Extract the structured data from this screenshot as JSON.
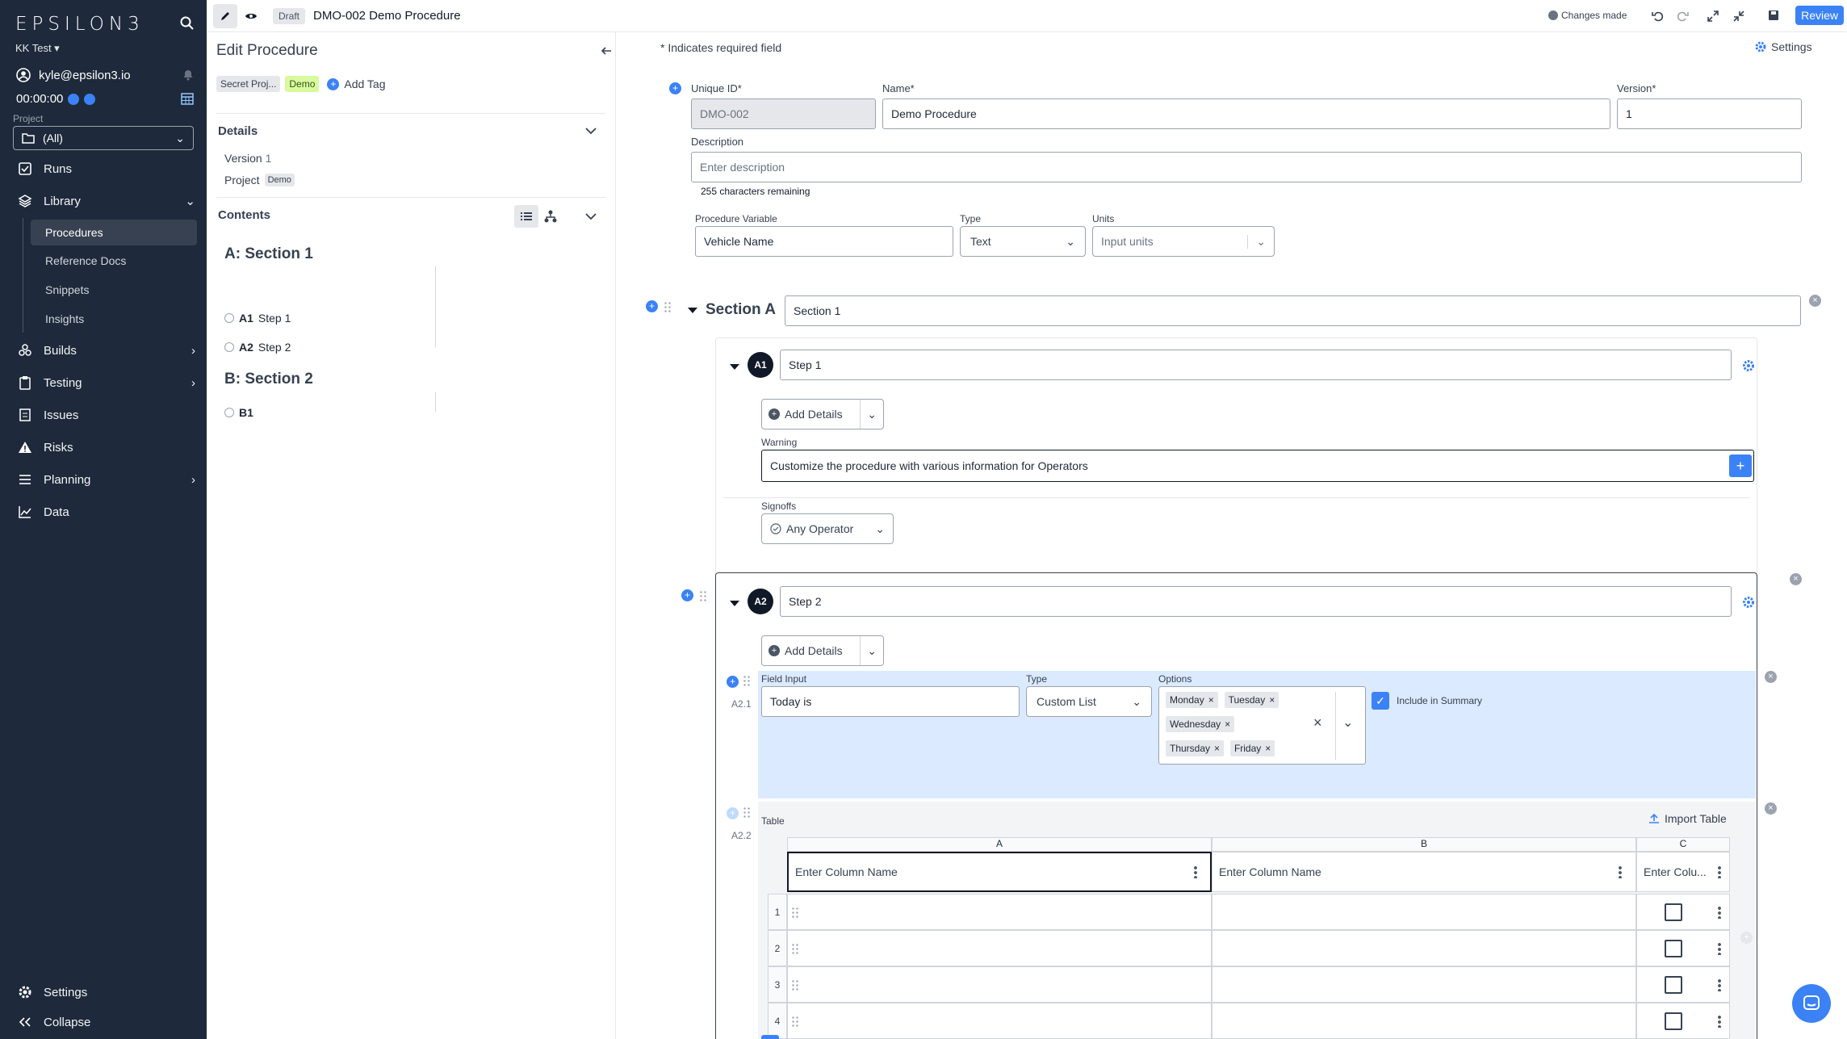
{
  "sidebar": {
    "logo": "EPSILON3",
    "org": "KK Test",
    "user": "kyle@epsilon3.io",
    "timer": "00:00:00",
    "project_label": "Project",
    "project_value": "(All)",
    "nav": [
      {
        "label": "Runs"
      },
      {
        "label": "Library"
      },
      {
        "label": "Builds"
      },
      {
        "label": "Testing"
      },
      {
        "label": "Issues"
      },
      {
        "label": "Risks"
      },
      {
        "label": "Planning"
      },
      {
        "label": "Data"
      }
    ],
    "library_items": [
      "Procedures",
      "Reference Docs",
      "Snippets",
      "Insights"
    ],
    "settings": "Settings",
    "collapse": "Collapse"
  },
  "topbar": {
    "status_badge": "Draft",
    "title": "DMO-002 Demo Procedure",
    "changes": "Changes made",
    "review": "Review"
  },
  "panel": {
    "title": "Edit Procedure",
    "tags": [
      "Secret Proj...",
      "Demo"
    ],
    "add_tag": "Add Tag",
    "details_header": "Details",
    "version_label": "Version",
    "version_value": "1",
    "project_label": "Project",
    "project_value": "Demo",
    "contents_header": "Contents",
    "sections": [
      {
        "title": "A: Section 1",
        "steps": [
          {
            "id": "A1",
            "name": "Step 1"
          },
          {
            "id": "A2",
            "name": "Step 2"
          }
        ]
      },
      {
        "title": "B: Section 2",
        "steps": [
          {
            "id": "B1",
            "name": ""
          }
        ]
      }
    ]
  },
  "main": {
    "required_note": "* Indicates required field",
    "settings": "Settings",
    "unique_id_label": "Unique ID*",
    "unique_id": "DMO-002",
    "name_label": "Name*",
    "name": "Demo Procedure",
    "version_label": "Version*",
    "version": "1",
    "description_label": "Description",
    "description_placeholder": "Enter description",
    "chars_remaining": "255 characters remaining",
    "proc_var_label": "Procedure Variable",
    "proc_var": "Vehicle Name",
    "type_label": "Type",
    "type": "Text",
    "units_label": "Units",
    "units_placeholder": "Input units",
    "section_label": "Section A",
    "section_name": "Section 1",
    "step1": {
      "num": "A1",
      "name": "Step 1",
      "add_details": "Add Details",
      "warning_label": "Warning",
      "warning_text": "Customize the procedure with various information for Operators",
      "signoffs_label": "Signoffs",
      "signoff_value": "Any Operator"
    },
    "step2": {
      "num": "A2",
      "name": "Step 2",
      "add_details": "Add Details",
      "field_id": "A2.1",
      "field_input_label": "Field Input",
      "field_input": "Today is",
      "type_label": "Type",
      "type": "Custom List",
      "options_label": "Options",
      "options": [
        "Monday",
        "Tuesday",
        "Wednesday",
        "Thursday",
        "Friday"
      ],
      "include_summary": "Include in Summary",
      "table_id": "A2.2",
      "table_label": "Table",
      "import_table": "Import Table",
      "columns": [
        "A",
        "B",
        "C"
      ],
      "col_placeholders": [
        "Enter Column Name",
        "Enter Column Name",
        "Enter Colu..."
      ],
      "rows": [
        "1",
        "2",
        "3",
        "4"
      ]
    }
  },
  "colors": {
    "sidebar_bg": "#1e2a3b",
    "accent": "#3b82f6",
    "tag_demo": "#d9f99d"
  }
}
